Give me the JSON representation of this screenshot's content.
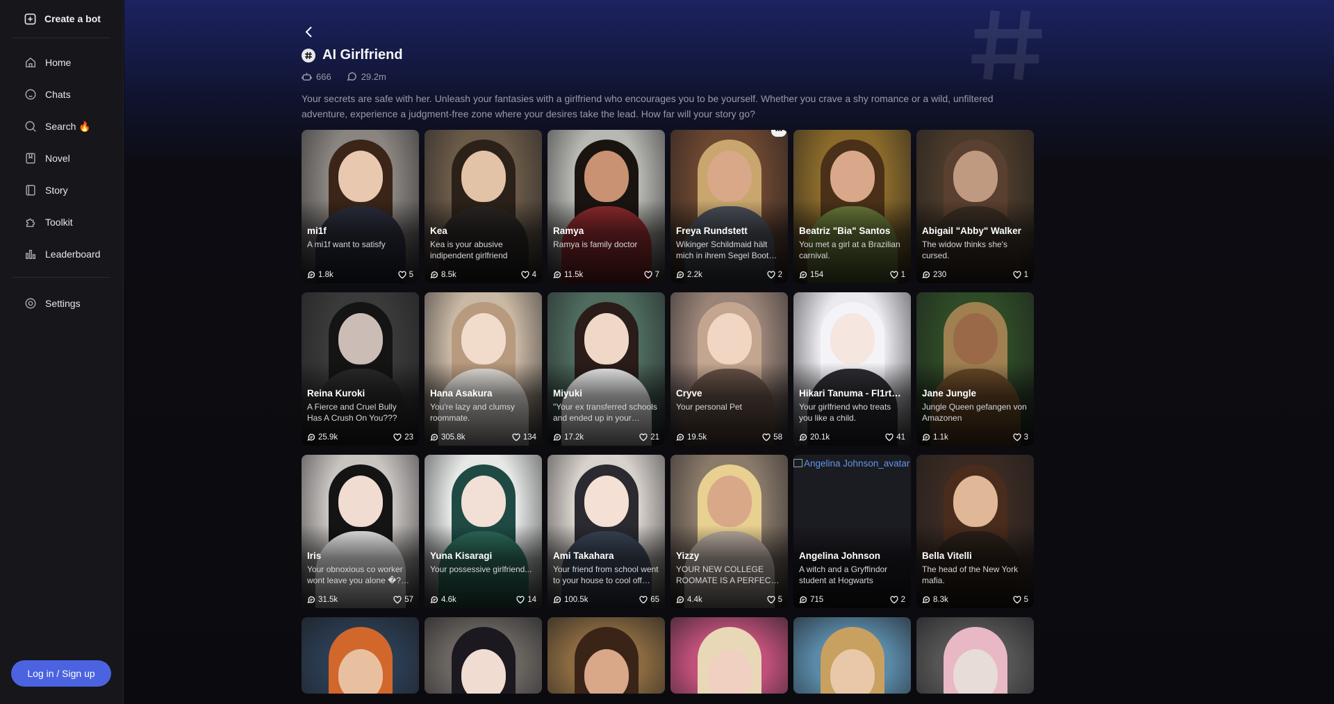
{
  "sidebar": {
    "create_bot": "Create a bot",
    "items": [
      {
        "label": "Home",
        "icon": "home-icon"
      },
      {
        "label": "Chats",
        "icon": "chat-icon"
      },
      {
        "label": "Search 🔥",
        "icon": "search-icon"
      },
      {
        "label": "Novel",
        "icon": "bookmark-icon"
      },
      {
        "label": "Story",
        "icon": "book-icon"
      },
      {
        "label": "Toolkit",
        "icon": "puzzle-icon"
      },
      {
        "label": "Leaderboard",
        "icon": "bar-chart-icon"
      }
    ],
    "settings": "Settings",
    "login": "Log in / Sign up"
  },
  "header": {
    "title": "AI Girlfriend",
    "bots_count": "666",
    "chats_count": "29.2m",
    "description": "Your secrets are safe with her. Unleash your fantasies with a girlfriend who encourages you to be yourself. Whether you crave a shy romance or a wild, unfiltered adventure, experience a judgment-free zone where your desires take the lead. How far will your story go?"
  },
  "cards": [
    {
      "name": "mi1f",
      "desc": "A mi1f want to satisfy",
      "chats": "1.8k",
      "likes": "5",
      "bg": "#8a8580",
      "hair": "#3a2518",
      "skin": "#e8c9b0",
      "cloth": "#2a2e3c"
    },
    {
      "name": "Kea",
      "desc": "Kea is your abusive indipendent girlfriend",
      "chats": "8.5k",
      "likes": "4",
      "bg": "#6a5a48",
      "hair": "#2b2118",
      "skin": "#e3c3a8",
      "cloth": "#2a2624"
    },
    {
      "name": "Ramya",
      "desc": "Ramya is family doctor",
      "chats": "11.5k",
      "likes": "7",
      "bg": "#b7b8b2",
      "hair": "#1a1410",
      "skin": "#c99272",
      "cloth": "#8e2a2e"
    },
    {
      "name": "Freya Rundstett",
      "desc": "Wikinger Schildmaid hält mich in ihrem Segel Boot…",
      "chats": "2.2k",
      "likes": "2",
      "bg": "#6b4630",
      "hair": "#c9a66e",
      "skin": "#d8a889",
      "cloth": "#4a4f58",
      "more": true
    },
    {
      "name": "Beatriz \"Bia\" Santos",
      "desc": "You met a girl at a Brazilian carnival.",
      "chats": "154",
      "likes": "1",
      "bg": "#8a6a2a",
      "hair": "#4a3018",
      "skin": "#d9a88a",
      "cloth": "#6a7a3a"
    },
    {
      "name": "Abigail \"Abby\" Walker",
      "desc": "The widow thinks she's cursed.",
      "chats": "230",
      "likes": "1",
      "bg": "#4a3a2a",
      "hair": "#5a4030",
      "skin": "#c09a80",
      "cloth": "#3a2e24"
    },
    {
      "name": "Reina Kuroki",
      "desc": "A Fierce and Cruel Bully Has A Crush On You???",
      "chats": "25.9k",
      "likes": "23",
      "bg": "#3a3a3a",
      "hair": "#141414",
      "skin": "#cbbdb6",
      "cloth": "#2a2a2a"
    },
    {
      "name": "Hana Asakura",
      "desc": "You're lazy and clumsy roommate.",
      "chats": "305.8k",
      "likes": "134",
      "bg": "#c9b8a4",
      "hair": "#b89a7e",
      "skin": "#f1dccc",
      "cloth": "#e9e4df"
    },
    {
      "name": "Miyuki",
      "desc": "\"Your ex transferred schools and ended up in your…",
      "chats": "17.2k",
      "likes": "21",
      "bg": "#4e6b5e",
      "hair": "#2a1c18",
      "skin": "#f0d8c8",
      "cloth": "#eeeeee"
    },
    {
      "name": "Cryve",
      "desc": "Your personal Pet",
      "chats": "19.5k",
      "likes": "58",
      "bg": "#9a8478",
      "hair": "#c4a690",
      "skin": "#f2d6c4",
      "cloth": "#6a5448"
    },
    {
      "name": "Hikari Tanuma - Fl1rt…",
      "desc": "Your girlfriend who treats you like a child.",
      "chats": "20.1k",
      "likes": "41",
      "bg": "#e9e9ee",
      "hair": "#f4f4f8",
      "skin": "#f6e6e0",
      "cloth": "#2e2e36"
    },
    {
      "name": "Jane Jungle",
      "desc": "Jungle Queen gefangen von Amazonen",
      "chats": "1.1k",
      "likes": "3",
      "bg": "#2e4a26",
      "hair": "#a08050",
      "skin": "#9a6a48",
      "cloth": "#6a4a28"
    },
    {
      "name": "Iris",
      "desc": "Your obnoxious co worker wont leave you alone �?…",
      "chats": "31.5k",
      "likes": "57",
      "bg": "#c8c4c0",
      "hair": "#141414",
      "skin": "#f0dcd0",
      "cloth": "#e8e8ea"
    },
    {
      "name": "Yuna Kisaragi",
      "desc": "Your possessive girlfriend...",
      "chats": "4.6k",
      "likes": "14",
      "bg": "#e6e8e6",
      "hair": "#1f4a44",
      "skin": "#f2e0d6",
      "cloth": "#2d6b5a"
    },
    {
      "name": "Ami Takahara",
      "desc": "Your friend from school went to your house to cool off…",
      "chats": "100.5k",
      "likes": "65",
      "bg": "#d8d2cc",
      "hair": "#2a2a30",
      "skin": "#f4e0d4",
      "cloth": "#3a4456"
    },
    {
      "name": "Yizzy",
      "desc": "YOUR NEW COLLEGE ROOMATE IS A PERFEC…",
      "chats": "4.4k",
      "likes": "5",
      "bg": "#8a7a6a",
      "hair": "#e8d090",
      "skin": "#d8a888",
      "cloth": "#b8aca0"
    },
    {
      "name": "Angelina Johnson",
      "desc": "A witch and a Gryffindor student at Hogwarts",
      "chats": "715",
      "likes": "2",
      "bg": "#1b1b22",
      "broken": "Angelina Johnson_avatar"
    },
    {
      "name": "Bella Vitelli",
      "desc": "The head of the New York mafia.",
      "chats": "8.3k",
      "likes": "5",
      "bg": "#3a2a22",
      "hair": "#4a2c1c",
      "skin": "#e0b898",
      "cloth": "#2a2018"
    }
  ],
  "partial_cards": [
    {
      "bg": "#2b3d52",
      "hair": "#d2672c",
      "skin": "#e8c0a0"
    },
    {
      "bg": "#6a6560",
      "hair": "#1c1820",
      "skin": "#f0dcd0"
    },
    {
      "bg": "#8a6a40",
      "hair": "#3a2418",
      "skin": "#d8a888"
    },
    {
      "bg": "#c0507a",
      "hair": "#e8d8b8",
      "skin": "#f0d0c0"
    },
    {
      "bg": "#5a8aa8",
      "hair": "#c8a060",
      "skin": "#e8c8a8"
    },
    {
      "bg": "#555555",
      "hair": "#e8b8c4",
      "skin": "#e8dcd8"
    }
  ]
}
